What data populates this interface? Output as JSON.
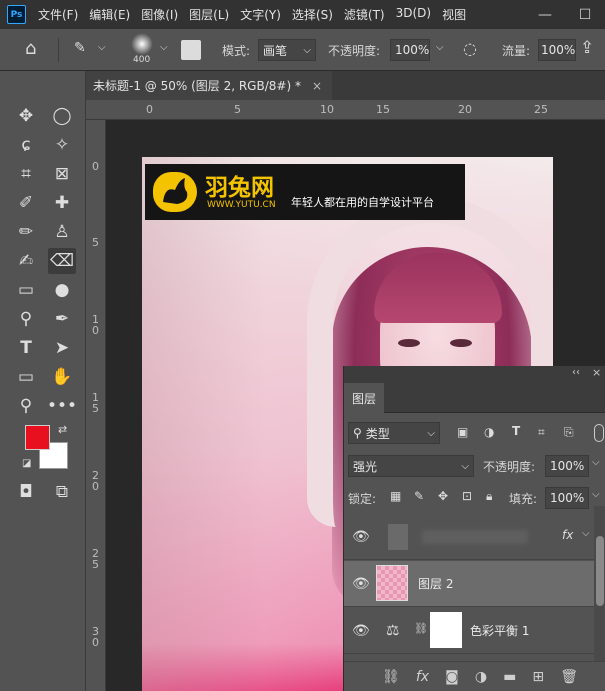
{
  "app": {
    "logo": "Ps"
  },
  "menu": [
    "文件(F)",
    "编辑(E)",
    "图像(I)",
    "图层(L)",
    "文字(Y)",
    "选择(S)",
    "滤镜(T)",
    "3D(D)",
    "视图"
  ],
  "window_controls": [
    "minimize-icon",
    "maximize-icon"
  ],
  "options": {
    "brush_size": "400",
    "mode_label": "模式:",
    "mode_value": "画笔",
    "opacity_label": "不透明度:",
    "opacity_value": "100%",
    "flow_label": "流量:",
    "flow_value": "100%"
  },
  "document_tab": {
    "title": "未标题-1 @ 50% (图层 2, RGB/8#) *",
    "close": "×"
  },
  "collapse": "««",
  "ruler_top": [
    "0",
    "5",
    "10",
    "15",
    "20",
    "25"
  ],
  "ruler_left": [
    "0",
    "5",
    "1\n0",
    "1\n5",
    "2\n0",
    "2\n5",
    "3\n0"
  ],
  "colors": {
    "foreground": "#e8101e",
    "background": "#ffffff",
    "accent": "#31a8ff",
    "watermark": "#f3c300"
  },
  "watermark": {
    "title": "羽兔网",
    "url": "WWW.YUTU.CN",
    "slogan": "年轻人都在用的自学设计平台"
  },
  "layers_panel": {
    "tab": "图层",
    "collapse": "‹‹",
    "close": "×",
    "filter_label": "类型",
    "blend_mode": "强光",
    "opacity_label": "不透明度:",
    "opacity_value": "100%",
    "lock_label": "锁定:",
    "fill_label": "填充:",
    "fill_value": "100%",
    "layers": [
      {
        "name": "",
        "fx": "fx"
      },
      {
        "name": "图层 2"
      },
      {
        "name": "色彩平衡 1"
      }
    ],
    "bottom_fx": "fx"
  }
}
